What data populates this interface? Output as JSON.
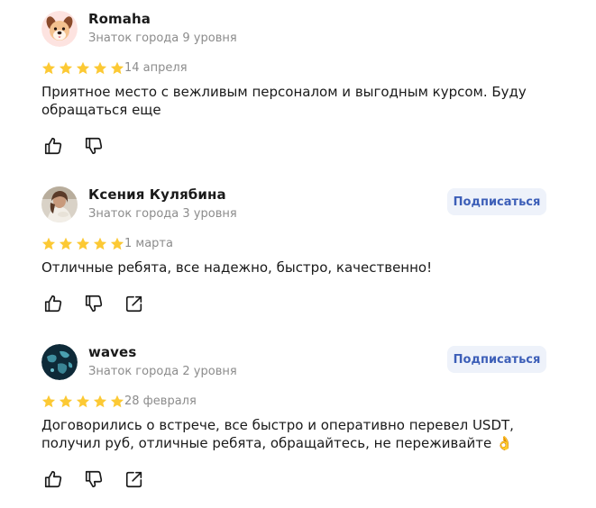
{
  "reviews": [
    {
      "author": "Romaha",
      "level": "Знаток города 9 уровня",
      "rating": 5,
      "date": "14 апреля",
      "text": "Приятное место с вежливым персоналом и выгодным курсом. Буду обращаться еще",
      "avatar_icon": "dog-emoji-avatar",
      "subscribe_label": null,
      "actions": [
        "like-icon",
        "dislike-icon"
      ]
    },
    {
      "author": "Ксения Кулябина",
      "level": "Знаток города 3 уровня",
      "rating": 5,
      "date": "1 марта",
      "text": "Отличные ребята, все надежно, быстро, качественно!",
      "avatar_icon": "photo-avatar",
      "subscribe_label": "Подписаться",
      "actions": [
        "like-icon",
        "dislike-icon",
        "share-icon"
      ]
    },
    {
      "author": "waves",
      "level": "Знаток города 2 уровня",
      "rating": 5,
      "date": "28 февраля",
      "text": "Договорились о встрече, все быстро и оперативно перевел USDT, получил руб, отличные ребята, обращайтесь, не переживайте 👌",
      "avatar_icon": "globe-avatar",
      "subscribe_label": "Подписаться",
      "actions": [
        "like-icon",
        "dislike-icon",
        "share-icon"
      ]
    }
  ],
  "colors": {
    "star": "#fcc934",
    "subscribe_bg": "#eef2fa",
    "subscribe_text": "#3d5fb8",
    "muted_text": "#8c8c8c",
    "icon": "#1a1a1a"
  }
}
